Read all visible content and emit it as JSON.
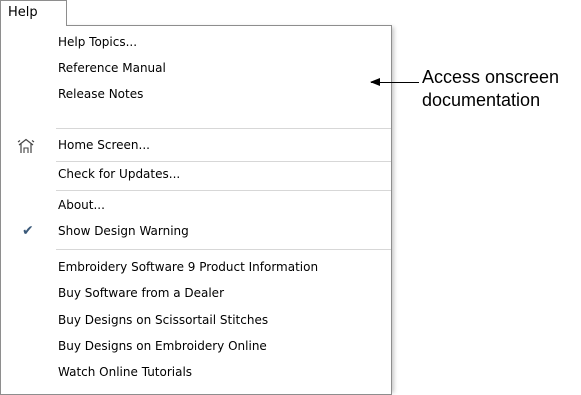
{
  "menubar": {
    "help_label": "Help"
  },
  "menu": {
    "items": [
      {
        "label": "Help Topics..."
      },
      {
        "label": "Reference Manual"
      },
      {
        "label": "Release Notes"
      },
      {
        "label": "Home Screen...",
        "icon": "home-screen-icon"
      },
      {
        "label": "Check for Updates..."
      },
      {
        "label": "About..."
      },
      {
        "label": "Show Design Warning",
        "checked": true,
        "icon": "checkmark-icon"
      },
      {
        "label": "Embroidery Software 9 Product Information"
      },
      {
        "label": "Buy Software from a Dealer"
      },
      {
        "label": "Buy Designs on Scissortail Stitches"
      },
      {
        "label": "Buy Designs on Embroidery Online"
      },
      {
        "label": "Watch Online Tutorials"
      }
    ]
  },
  "callout": {
    "line1": "Access onscreen",
    "line2": "documentation"
  },
  "colors": {
    "border": "#8e8e8e",
    "separator": "#d7d7d7",
    "check": "#3b5a7a"
  }
}
